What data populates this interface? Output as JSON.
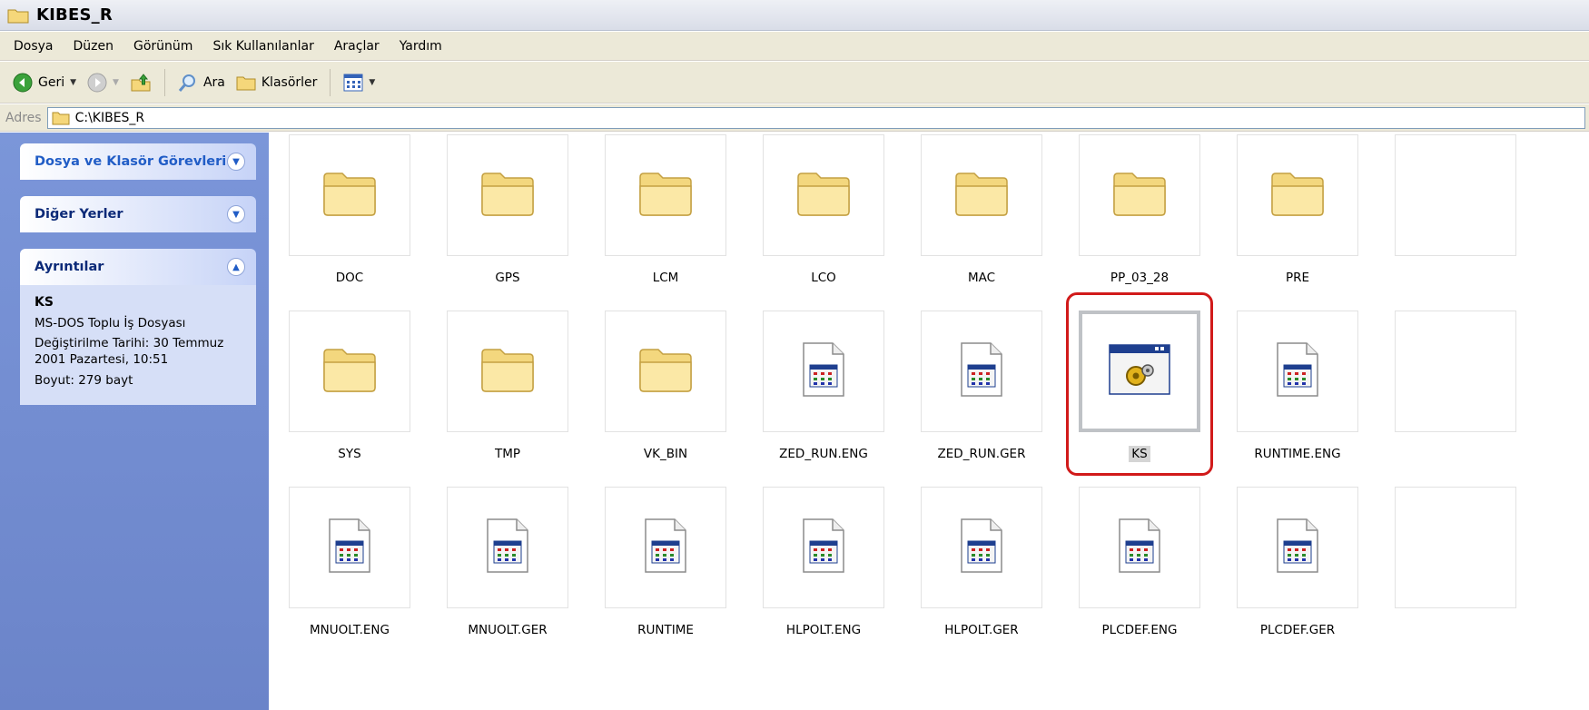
{
  "window": {
    "title": "KIBES_R"
  },
  "menu": [
    "Dosya",
    "Düzen",
    "Görünüm",
    "Sık Kullanılanlar",
    "Araçlar",
    "Yardım"
  ],
  "toolbar": {
    "back": "Geri",
    "search": "Ara",
    "folders": "Klasörler"
  },
  "address": {
    "label": "Adres",
    "path": "C:\\KIBES_R"
  },
  "taskpane": {
    "tasks_title": "Dosya ve Klasör Görevleri",
    "other_title": "Diğer Yerler",
    "details_title": "Ayrıntılar",
    "details": {
      "name": "KS",
      "type": "MS-DOS Toplu İş Dosyası",
      "modified": "Değiştirilme Tarihi: 30 Temmuz 2001 Pazartesi, 10:51",
      "size": "Boyut: 279 bayt"
    }
  },
  "items": [
    {
      "label": "DOC",
      "kind": "folder"
    },
    {
      "label": "GPS",
      "kind": "folder"
    },
    {
      "label": "LCM",
      "kind": "folder"
    },
    {
      "label": "LCO",
      "kind": "folder"
    },
    {
      "label": "MAC",
      "kind": "folder"
    },
    {
      "label": "PP_03_28",
      "kind": "folder"
    },
    {
      "label": "PRE",
      "kind": "folder"
    },
    {
      "label": "SYS",
      "kind": "folder"
    },
    {
      "label": "TMP",
      "kind": "folder"
    },
    {
      "label": "VK_BIN",
      "kind": "folder"
    },
    {
      "label": "ZED_RUN.ENG",
      "kind": "file"
    },
    {
      "label": "ZED_RUN.GER",
      "kind": "file"
    },
    {
      "label": "KS",
      "kind": "batch",
      "selected": true
    },
    {
      "label": "RUNTIME.ENG",
      "kind": "file"
    },
    {
      "label": "MNUOLT.ENG",
      "kind": "file"
    },
    {
      "label": "MNUOLT.GER",
      "kind": "file"
    },
    {
      "label": "RUNTIME",
      "kind": "file"
    },
    {
      "label": "HLPOLT.ENG",
      "kind": "file"
    },
    {
      "label": "HLPOLT.GER",
      "kind": "file"
    },
    {
      "label": "PLCDEF.ENG",
      "kind": "file"
    },
    {
      "label": "PLCDEF.GER",
      "kind": "file"
    }
  ],
  "colors": {
    "highlight": "#d11a1a",
    "taskpane": "#7b96d9",
    "panel_title": "#215dc6"
  }
}
